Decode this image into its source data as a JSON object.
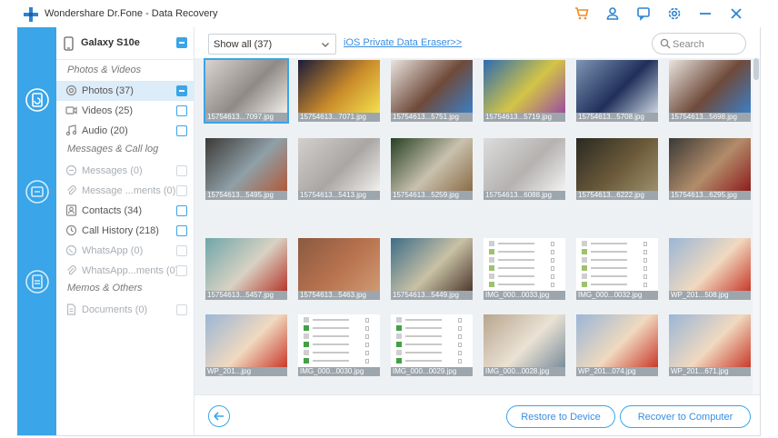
{
  "app": {
    "title": "Wondershare Dr.Fone - Data Recovery",
    "accent": "#3aa5e8"
  },
  "titlebar_icons": [
    "cart-icon",
    "user-icon",
    "feedback-icon",
    "settings-icon",
    "minimize-icon",
    "close-icon"
  ],
  "rail": {
    "items": [
      "recover-device-icon",
      "recover-itunes-icon",
      "recover-icloud-icon"
    ]
  },
  "device": {
    "name": "Galaxy S10e"
  },
  "groups": {
    "photos_videos": "Photos & Videos",
    "messages_calllog": "Messages & Call log",
    "memos_others": "Memos & Others"
  },
  "categories": [
    {
      "label": "Photos (37)",
      "icon": "photo-icon"
    },
    {
      "label": "Videos (25)",
      "icon": "video-icon"
    },
    {
      "label": "Audio (20)",
      "icon": "music-icon"
    },
    {
      "label": "Messages (0)",
      "icon": "message-icon"
    },
    {
      "label": "Message ...ments (0)",
      "icon": "attachment-icon"
    },
    {
      "label": "Contacts (34)",
      "icon": "contact-icon"
    },
    {
      "label": "Call History (218)",
      "icon": "clock-icon"
    },
    {
      "label": "WhatsApp (0)",
      "icon": "whatsapp-icon"
    },
    {
      "label": "WhatsApp...ments (0)",
      "icon": "attachment-icon"
    },
    {
      "label": "Documents (0)",
      "icon": "document-icon"
    }
  ],
  "toolbar": {
    "filter_value": "Show all (37)",
    "link_text": "iOS Private Data Eraser>>",
    "search_placeholder": "Search"
  },
  "files": [
    "15754613...7097.jpg",
    "15754613...7071.jpg",
    "15754613...5751.jpg",
    "15754613...5719.jpg",
    "15754613...5708.jpg",
    "15754613...5698.jpg",
    "15754613...5495.jpg",
    "15754613...5413.jpg",
    "15754613...5259.jpg",
    "15754613...6088.jpg",
    "15754613...6222.jpg",
    "15754613...6295.jpg",
    "15754613...5457.jpg",
    "15754613...5463.jpg",
    "15754613...5449.jpg",
    "IMG_000...0033.jpg",
    "IMG_000...0032.jpg",
    "WP_201...508.jpg",
    "WP_201...jpg",
    "IMG_000...0030.jpg",
    "IMG_000...0029.jpg",
    "IMG_000...0028.jpg",
    "WP_201...074.jpg",
    "WP_201...671.jpg"
  ],
  "buttons": {
    "restore": "Restore to Device",
    "recover": "Recover to Computer"
  }
}
